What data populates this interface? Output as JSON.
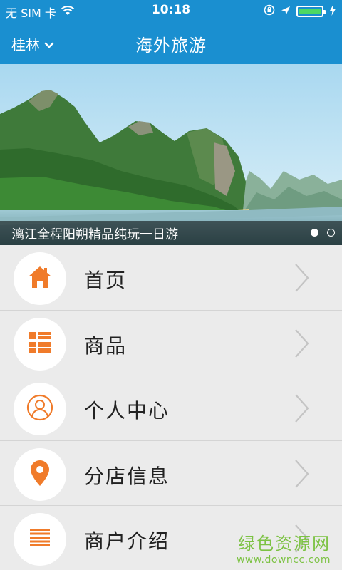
{
  "status_bar": {
    "carrier": "无 SIM 卡",
    "time": "10:18",
    "battery_level": 1.0,
    "icons": [
      "wifi-icon",
      "rotation-lock-icon",
      "location-arrow-icon",
      "battery-icon",
      "charging-icon"
    ]
  },
  "header": {
    "city": "桂林",
    "title": "海外旅游"
  },
  "banner": {
    "caption": "漓江全程阳朔精品纯玩一日游",
    "slide_count": 2,
    "active_slide": 1
  },
  "menu": {
    "items": [
      {
        "label": "首页",
        "icon": "home-icon"
      },
      {
        "label": "商品",
        "icon": "grid-list-icon"
      },
      {
        "label": "个人中心",
        "icon": "user-icon"
      },
      {
        "label": "分店信息",
        "icon": "map-pin-icon"
      },
      {
        "label": "商户介绍",
        "icon": "lines-icon"
      }
    ]
  },
  "watermark": {
    "title": "绿色资源网",
    "url": "www.downcc.com"
  },
  "colors": {
    "header_blue": "#1a8fd0",
    "icon_orange": "#f07b2a",
    "list_bg": "#ebebeb",
    "watermark_green": "#7cc243"
  }
}
